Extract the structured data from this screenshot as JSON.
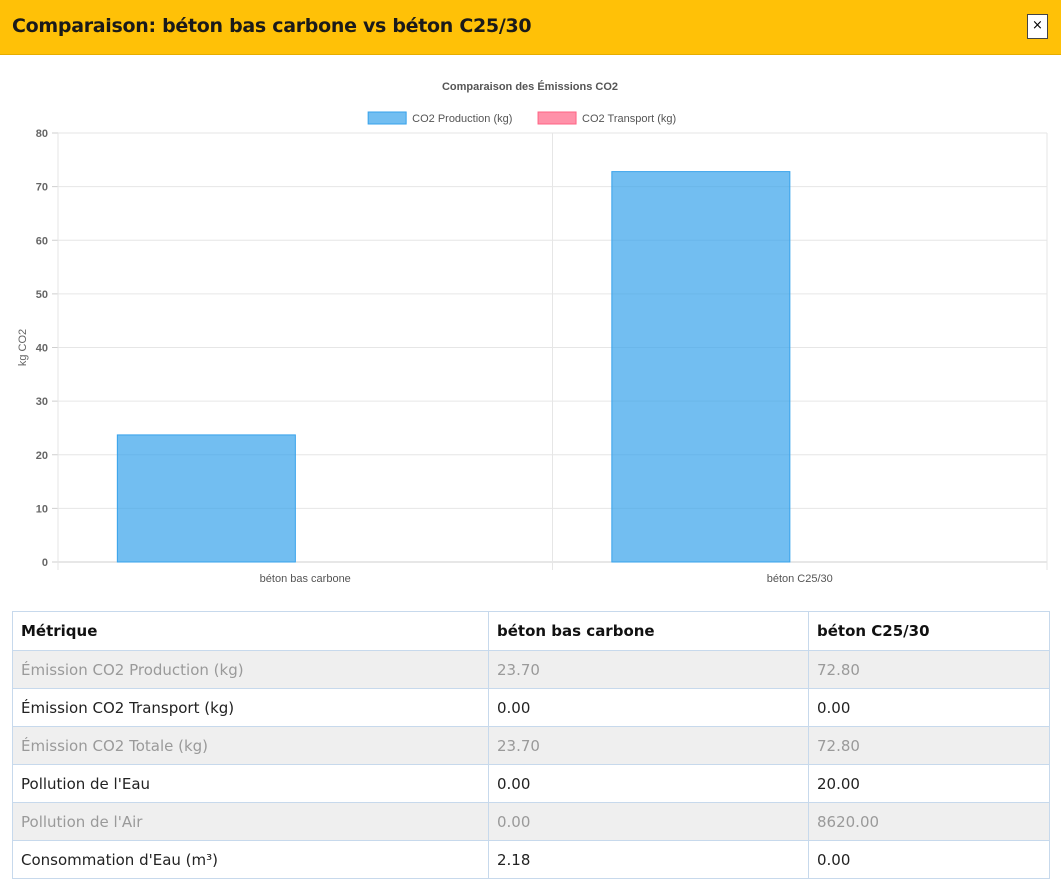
{
  "modal": {
    "title": "Comparaison: béton bas carbone vs béton C25/30",
    "close_label": "×"
  },
  "chart_data": {
    "type": "bar",
    "title": "Comparaison des Émissions CO2",
    "categories": [
      "béton bas carbone",
      "béton C25/30"
    ],
    "series": [
      {
        "name": "CO2 Production (kg)",
        "values": [
          23.7,
          72.8
        ],
        "color": "#36a2eb"
      },
      {
        "name": "CO2 Transport (kg)",
        "values": [
          0,
          0
        ],
        "color": "#ff6384"
      }
    ],
    "xlabel": "",
    "ylabel": "kg CO2",
    "ylim": [
      0,
      80
    ],
    "yticks": [
      0,
      10,
      20,
      30,
      40,
      50,
      60,
      70,
      80
    ],
    "legend_position": "top",
    "grid": true
  },
  "table": {
    "headers": [
      "Métrique",
      "béton bas carbone",
      "béton C25/30"
    ],
    "rows": [
      [
        "Émission CO2 Production (kg)",
        "23.70",
        "72.80"
      ],
      [
        "Émission CO2 Transport (kg)",
        "0.00",
        "0.00"
      ],
      [
        "Émission CO2 Totale (kg)",
        "23.70",
        "72.80"
      ],
      [
        "Pollution de l'Eau",
        "0.00",
        "20.00"
      ],
      [
        "Pollution de l'Air",
        "0.00",
        "8620.00"
      ],
      [
        "Consommation d'Eau (m³)",
        "2.18",
        "0.00"
      ]
    ]
  }
}
